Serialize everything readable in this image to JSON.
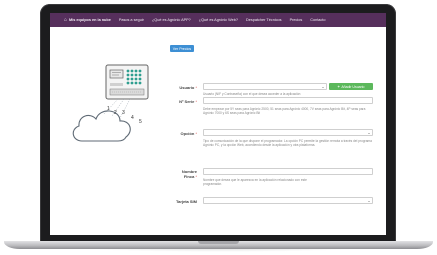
{
  "nav": {
    "items": [
      {
        "label": "Mis equipos en la nube",
        "active": true
      },
      {
        "label": "Pasos a seguir"
      },
      {
        "label": "¿Qué es Agrónic APP?"
      },
      {
        "label": "¿Qué es Agrónic Web?"
      },
      {
        "label": "Despatcher Técnicos"
      },
      {
        "label": "Precios"
      },
      {
        "label": "Contacto"
      }
    ]
  },
  "ver_precios": "Ver Precios",
  "keypad_digits": [
    "1",
    "2",
    "3",
    "4",
    "5"
  ],
  "form": {
    "usuario": {
      "label": "Usuario",
      "required_mark": "*",
      "add_button": "Añadir Usuario",
      "help": "Usuario (NIF y Contraseña) con el que desea acceder a la aplicación"
    },
    "serie": {
      "label": "Nº Serie",
      "required_mark": "*",
      "help": "Debe empezar por 5Y seas para Agrónic 2500, 51 seas para Agrónic 4000, 7V seas para Agrónic Bit, 4P seas para Agrónic 7000 y 6S seas para Agrónic Bit"
    },
    "opcion": {
      "label": "Opción",
      "required_mark": "*",
      "help": "Tipo de comunicación de la que dispone el programador. La opción PC permite la gestión remota a través del programa Agrónic PC, y la opción Web, accediendo desde la aplicación y otra plataforma."
    },
    "nombre": {
      "label_line1": "Nombre",
      "label_line2": "Finca",
      "required_mark": "*",
      "help": "Nombre que desea que le aparezca en la aplicación relacionado con este programador."
    },
    "tarjeta": {
      "label": "Tarjeta SIM"
    }
  },
  "colors": {
    "navbar": "#562f5c",
    "primary_button": "#3d8fd4",
    "success_button": "#5cb85c",
    "required": "#d9534f"
  },
  "icons": [
    "home-icon",
    "plus-icon",
    "cloud-icon",
    "controller-icon",
    "dropdown-caret-icon"
  ]
}
